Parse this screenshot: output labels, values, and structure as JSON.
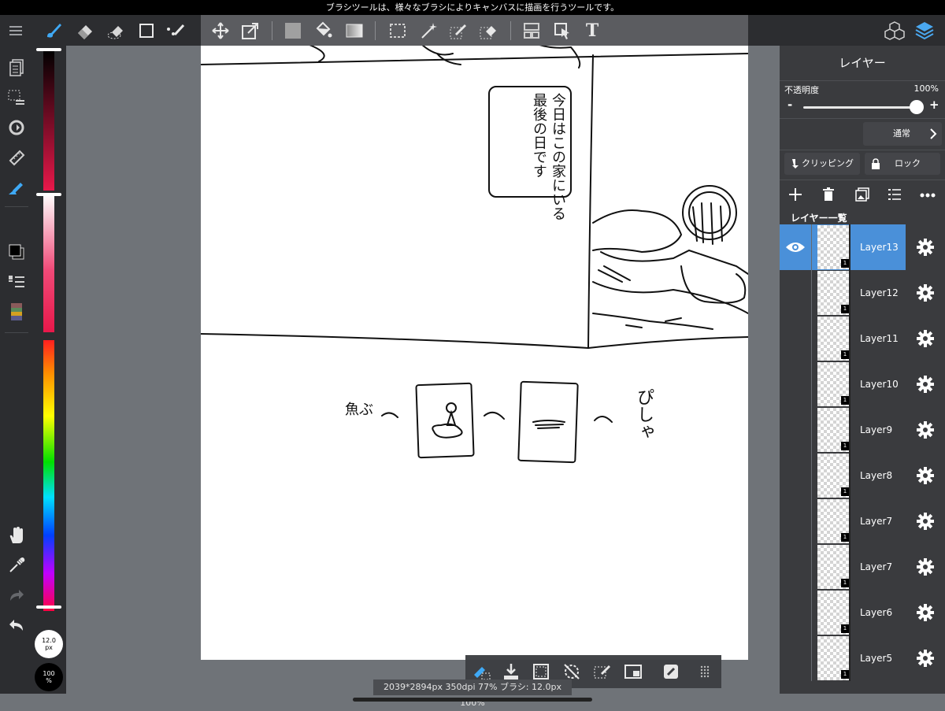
{
  "status_bar": {
    "hint": "ブラシツールは、様々なブラシによりキャンバスに描画を行うツールです。"
  },
  "toolbar": {
    "icons": [
      "menu-icon",
      "brush-icon",
      "eraser-icon",
      "blur-eraser-icon",
      "rect-icon",
      "dot-line-icon",
      "move-icon",
      "transform-icon",
      "fill-color-icon",
      "bucket-icon",
      "gradient-icon",
      "select-rect-icon",
      "magic-wand-icon",
      "select-pen-icon",
      "select-eraser-icon",
      "layout-icon",
      "select-move-icon",
      "text-icon",
      "materials-icon",
      "layers-icon"
    ],
    "text_tool_label": "T"
  },
  "color_strip": {
    "brush_size": "12.0",
    "brush_size_unit": "px",
    "opacity": "100",
    "opacity_unit": "%"
  },
  "layer_panel": {
    "title": "レイヤー",
    "opacity_label": "不透明度",
    "opacity_value": "100%",
    "minus_label": "-",
    "plus_label": "+",
    "blend_mode": "通常",
    "clipping_label": "クリッピング",
    "lock_label": "ロック",
    "list_title": "レイヤー一覧",
    "active_color": "#4a90d9",
    "layers": [
      {
        "name": "Layer13",
        "badge": "1"
      },
      {
        "name": "Layer12",
        "badge": "1"
      },
      {
        "name": "Layer11",
        "badge": "1"
      },
      {
        "name": "Layer10",
        "badge": "1"
      },
      {
        "name": "Layer9",
        "badge": "1"
      },
      {
        "name": "Layer8",
        "badge": "1"
      },
      {
        "name": "Layer7",
        "badge": "1"
      },
      {
        "name": "Layer7",
        "badge": "1"
      },
      {
        "name": "Layer6",
        "badge": "1"
      },
      {
        "name": "Layer5",
        "badge": "1"
      }
    ]
  },
  "canvas": {
    "speech_text": "今日はこの家にいる最後の日です",
    "bottom_left_text": "魚ぶ",
    "bottom_right_text": "ぴしゃ"
  },
  "info_bar": {
    "text": "2039*2894px 350dpi 77% ブラシ: 12.0px 100%"
  }
}
